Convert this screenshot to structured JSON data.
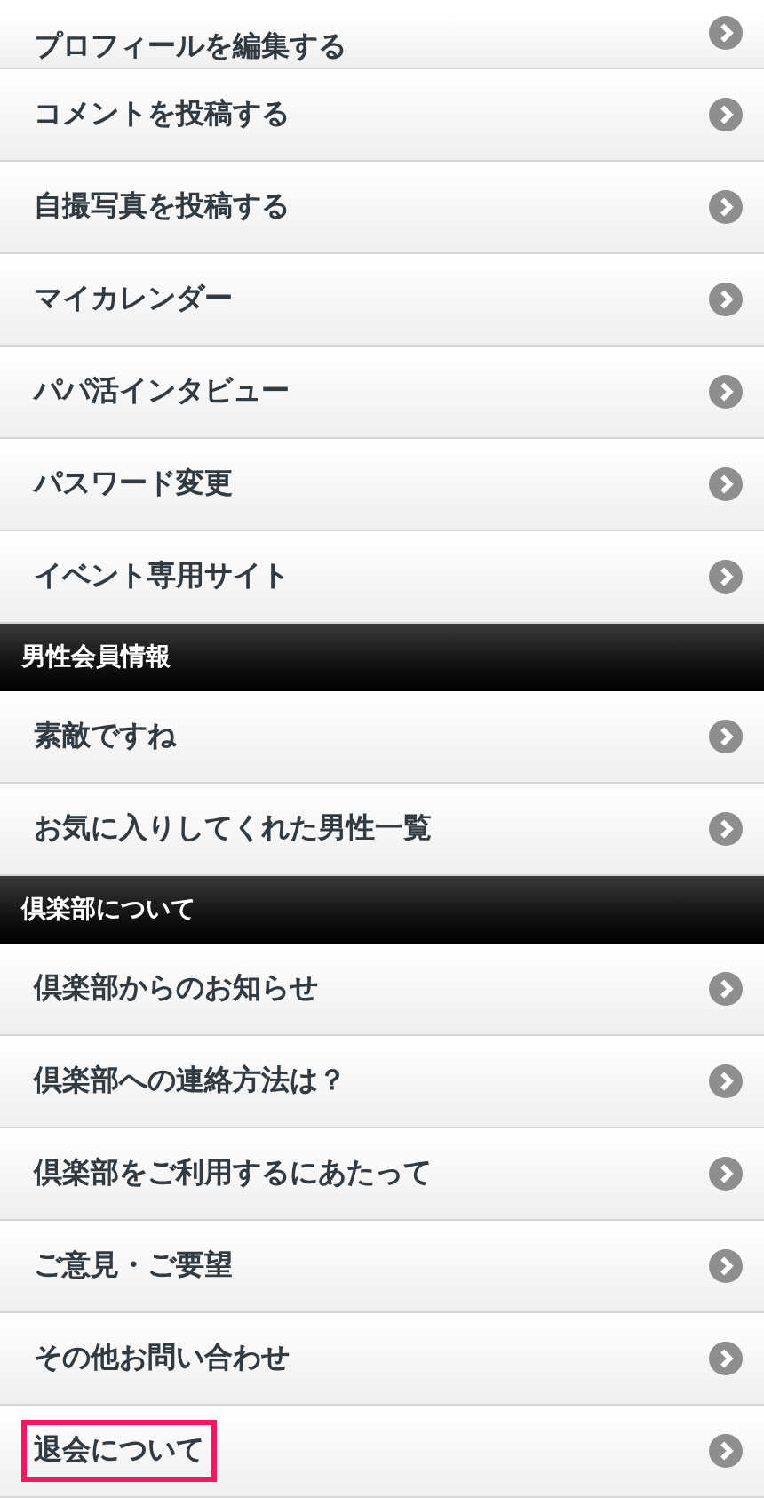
{
  "sections": [
    {
      "items": [
        {
          "label": "プロフィールを編集する",
          "highlighted": false
        },
        {
          "label": "コメントを投稿する",
          "highlighted": false
        },
        {
          "label": "自撮写真を投稿する",
          "highlighted": false
        },
        {
          "label": "マイカレンダー",
          "highlighted": false
        },
        {
          "label": "パパ活インタビュー",
          "highlighted": false
        },
        {
          "label": "パスワード変更",
          "highlighted": false
        },
        {
          "label": "イベント専用サイト",
          "highlighted": false
        }
      ]
    },
    {
      "header": "男性会員情報",
      "items": [
        {
          "label": "素敵ですね",
          "highlighted": false
        },
        {
          "label": "お気に入りしてくれた男性一覧",
          "highlighted": false
        }
      ]
    },
    {
      "header": "倶楽部について",
      "items": [
        {
          "label": "倶楽部からのお知らせ",
          "highlighted": false
        },
        {
          "label": "倶楽部への連絡方法は？",
          "highlighted": false
        },
        {
          "label": "倶楽部をご利用するにあたって",
          "highlighted": false
        },
        {
          "label": "ご意見・ご要望",
          "highlighted": false
        },
        {
          "label": "その他お問い合わせ",
          "highlighted": false
        },
        {
          "label": "退会について",
          "highlighted": true
        }
      ]
    }
  ]
}
